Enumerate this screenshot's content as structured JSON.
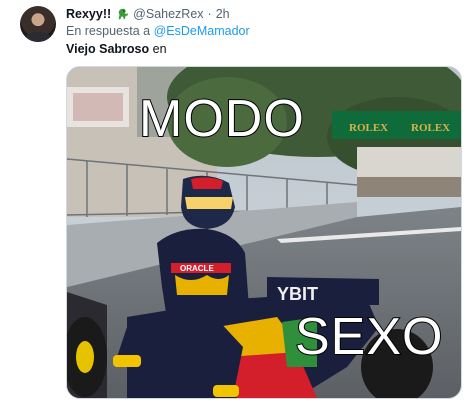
{
  "author": {
    "name": "Rexyy!!",
    "handle": "@SahezRex",
    "separator": "·",
    "time": "2h"
  },
  "reply": {
    "prefix": "En respuesta a",
    "mention": "@EsDeMamador"
  },
  "tweet": {
    "bold_text": "Viejo Sabroso",
    "rest_text": " en"
  },
  "meme": {
    "top_text": "MODO",
    "bottom_text": "SEXO",
    "banner_texts": [
      "ROLEX",
      "ROLEX",
      "ORACLE",
      "YBIT"
    ]
  },
  "colors": {
    "link": "#1d9bf0",
    "muted": "#536471",
    "rolex_green": "#0f6b3a",
    "rolex_gold": "#d8b24a",
    "rb_navy": "#1a1f3d"
  }
}
